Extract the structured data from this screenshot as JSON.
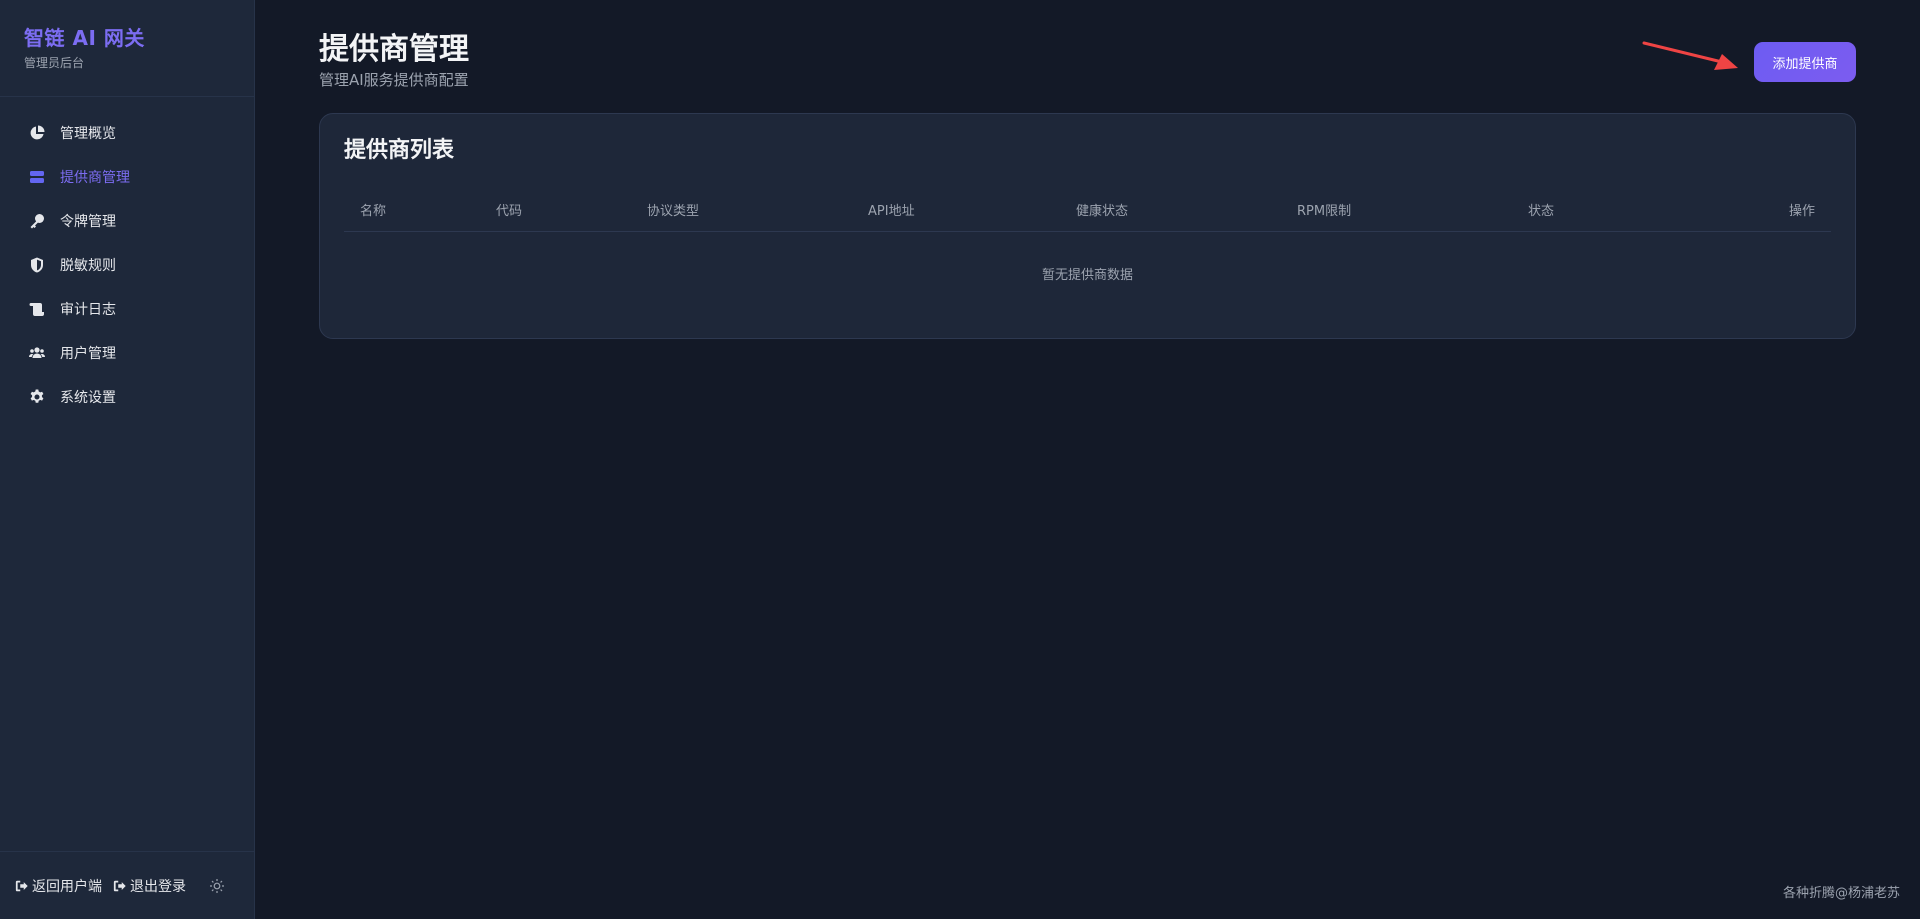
{
  "sidebar": {
    "brand_title": "智链 AI 网关",
    "brand_subtitle": "管理员后台",
    "items": [
      {
        "label": "管理概览",
        "icon": "pie-chart-icon",
        "active": false
      },
      {
        "label": "提供商管理",
        "icon": "server-icon",
        "active": true
      },
      {
        "label": "令牌管理",
        "icon": "key-icon",
        "active": false
      },
      {
        "label": "脱敏规则",
        "icon": "shield-icon",
        "active": false
      },
      {
        "label": "审计日志",
        "icon": "scroll-icon",
        "active": false
      },
      {
        "label": "用户管理",
        "icon": "users-icon",
        "active": false
      },
      {
        "label": "系统设置",
        "icon": "gear-icon",
        "active": false
      }
    ],
    "footer": {
      "back_label": "返回用户端",
      "logout_label": "退出登录",
      "theme_icon": "sun-icon"
    }
  },
  "header": {
    "title": "提供商管理",
    "subtitle": "管理AI服务提供商配置",
    "add_button": "添加提供商"
  },
  "card": {
    "title": "提供商列表",
    "columns": [
      "名称",
      "代码",
      "协议类型",
      "API地址",
      "健康状态",
      "RPM限制",
      "状态",
      "操作"
    ],
    "empty_text": "暂无提供商数据"
  },
  "watermark": "各种折腾@杨浦老苏",
  "colors": {
    "accent": "#7c6df2",
    "background": "#131927",
    "sidebar": "#1e283a",
    "annotation_arrow": "#ef4444"
  }
}
